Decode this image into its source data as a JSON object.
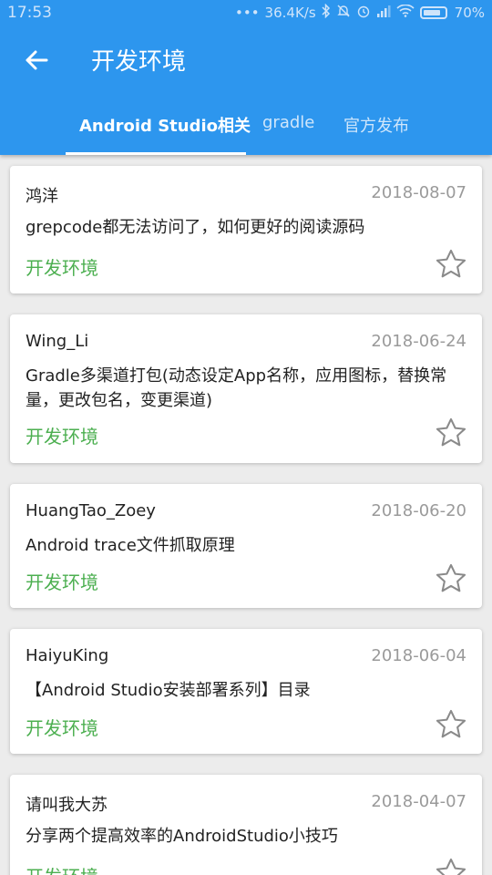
{
  "status_bar": {
    "time": "17:53",
    "dots": "•••",
    "net_speed": "36.4K/s",
    "battery": "70%"
  },
  "toolbar": {
    "title": "开发环境",
    "back_icon": "arrow-back-icon"
  },
  "tabs": [
    {
      "label": "Android Studio相关",
      "active": true
    },
    {
      "label": "gradle",
      "active": false
    },
    {
      "label": "官方发布",
      "active": false
    }
  ],
  "colors": {
    "primary": "#2d96ee",
    "tag": "#4caf50",
    "date": "#9a9a9a"
  },
  "articles": [
    {
      "author": "鸿洋",
      "date": "2018-08-07",
      "title": "grepcode都无法访问了，如何更好的阅读源码",
      "tag": "开发环境"
    },
    {
      "author": "Wing_Li",
      "date": "2018-06-24",
      "title": "Gradle多渠道打包(动态设定App名称，应用图标，替换常量，更改包名，变更渠道)",
      "tag": "开发环境"
    },
    {
      "author": "HuangTao_Zoey",
      "date": "2018-06-20",
      "title": "Android trace文件抓取原理",
      "tag": "开发环境"
    },
    {
      "author": "HaiyuKing",
      "date": "2018-06-04",
      "title": "【Android Studio安装部署系列】目录",
      "tag": "开发环境"
    },
    {
      "author": "请叫我大苏",
      "date": "2018-04-07",
      "title": "分享两个提高效率的AndroidStudio小技巧",
      "tag": "开发环境"
    }
  ]
}
